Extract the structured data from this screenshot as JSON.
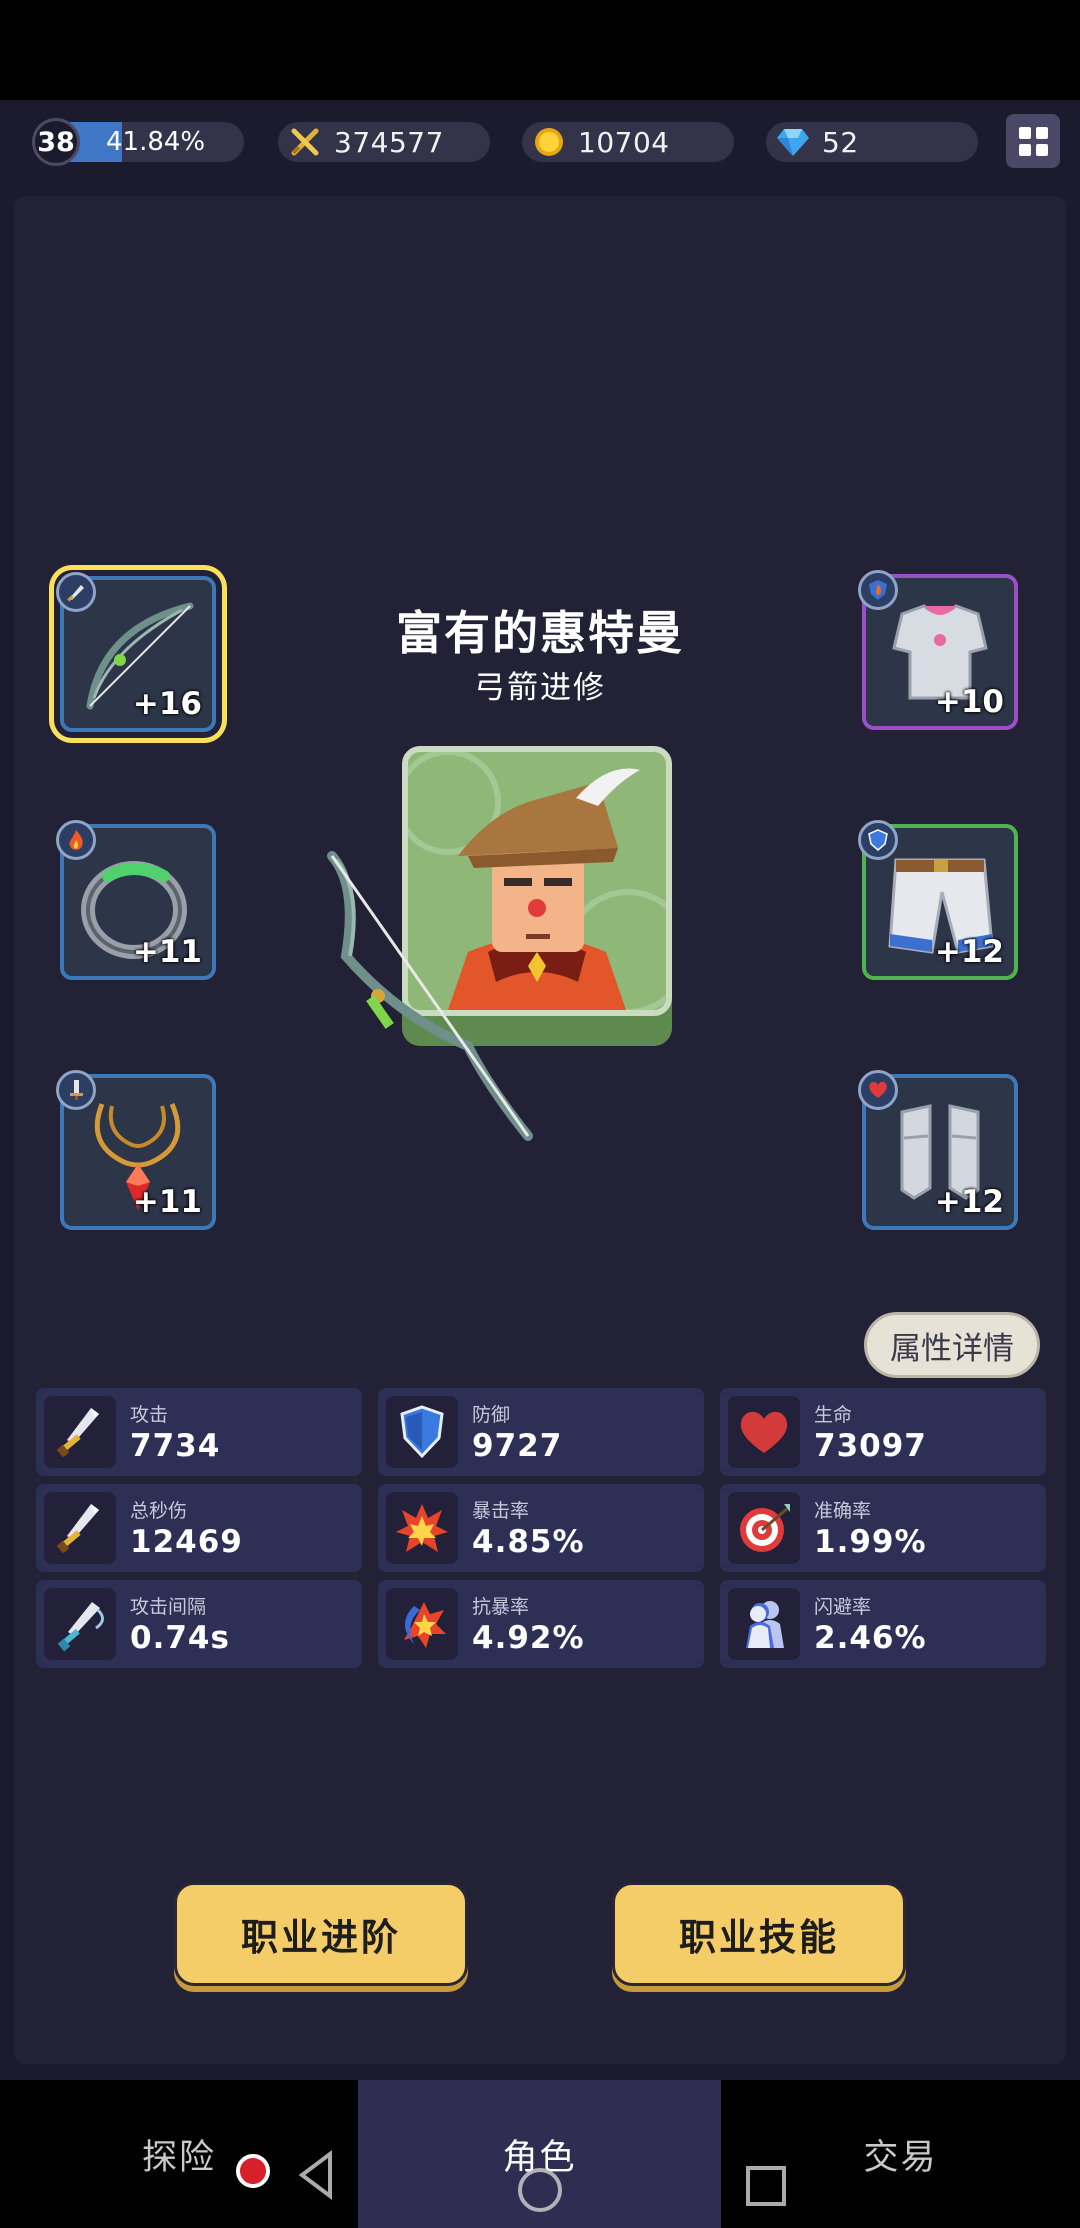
{
  "player": {
    "level": "38",
    "exp_percent": "41.84%",
    "exp_fraction": 0.4184
  },
  "resources": {
    "power": "374577",
    "gold": "10704",
    "diamonds": "52"
  },
  "hero": {
    "name": "富有的惠特曼",
    "class": "弓箭进修"
  },
  "equipment": {
    "weapon": {
      "level": "+16",
      "icon": "bow-icon",
      "badge": "dagger-icon",
      "rarity": "blue",
      "selected": true
    },
    "ring": {
      "level": "+11",
      "icon": "ring-icon",
      "badge": "fire-icon",
      "rarity": "blue"
    },
    "necklace": {
      "level": "+11",
      "icon": "necklace-icon",
      "badge": "sword-icon",
      "rarity": "blue"
    },
    "armor": {
      "level": "+10",
      "icon": "armor-icon",
      "badge": "fire-shield-icon",
      "rarity": "purple"
    },
    "pants": {
      "level": "+12",
      "icon": "pants-icon",
      "badge": "shield-icon",
      "rarity": "green"
    },
    "boots": {
      "level": "+12",
      "icon": "boots-icon",
      "badge": "heart-icon",
      "rarity": "blue"
    }
  },
  "detail_button": "属性详情",
  "stats": [
    {
      "label": "攻击",
      "value": "7734",
      "icon": "sword-icon"
    },
    {
      "label": "防御",
      "value": "9727",
      "icon": "shield-icon"
    },
    {
      "label": "生命",
      "value": "73097",
      "icon": "heart-icon"
    },
    {
      "label": "总秒伤",
      "value": "12469",
      "icon": "sword-icon"
    },
    {
      "label": "暴击率",
      "value": "4.85%",
      "icon": "explosion-icon"
    },
    {
      "label": "准确率",
      "value": "1.99%",
      "icon": "target-icon"
    },
    {
      "label": "攻击间隔",
      "value": "0.74s",
      "icon": "swift-sword-icon"
    },
    {
      "label": "抗暴率",
      "value": "4.92%",
      "icon": "anti-crit-icon"
    },
    {
      "label": "闪避率",
      "value": "2.46%",
      "icon": "dodge-icon"
    }
  ],
  "buttons": {
    "advance": "职业进阶",
    "skills": "职业技能"
  },
  "nav": {
    "explore": "探险",
    "character": "角色",
    "trade": "交易",
    "active": "角色"
  },
  "colors": {
    "background": "#1c1b2e",
    "panel": "#232136",
    "stat_card": "#2d2f55",
    "button_yellow": "#f4cc68",
    "exp_blue": "#3f77c6",
    "rarity_blue": "#3d78b8",
    "rarity_purple": "#9b4fc7",
    "rarity_green": "#4fb34f",
    "selected_glow": "#f7e05a"
  }
}
